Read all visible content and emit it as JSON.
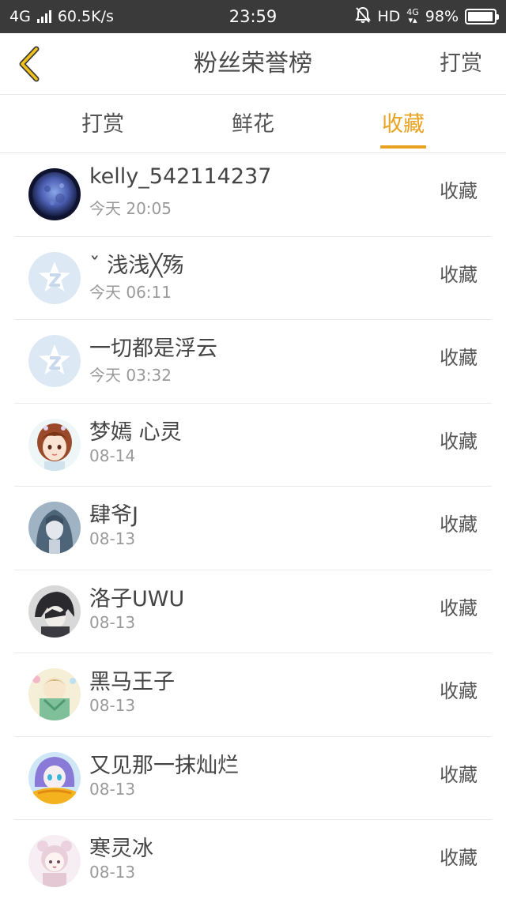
{
  "status_bar": {
    "network": "4G",
    "speed": "60.5K/s",
    "time": "23:59",
    "hd": "HD",
    "hd_sub_top": "4G",
    "hd_sub_bottom": "▾▴",
    "battery": "98%",
    "battery_level": 0.98,
    "icons": [
      "signal-bars-icon",
      "mute-bell-icon",
      "battery-icon"
    ]
  },
  "nav": {
    "title": "粉丝荣誉榜",
    "right_action": "打赏",
    "back_icon": "chevron-left-icon",
    "accent_color": "#e9a21f"
  },
  "tabs": [
    {
      "label": "打赏",
      "active": false
    },
    {
      "label": "鲜花",
      "active": false
    },
    {
      "label": "收藏",
      "active": true
    }
  ],
  "fans": [
    {
      "name": "kelly_542114237",
      "time": "今天 20:05",
      "action": "收藏",
      "avatar": "moon-avatar"
    },
    {
      "name": "ˇ 浅浅╳殇",
      "time": "今天 06:11",
      "action": "收藏",
      "avatar": "default-star-avatar"
    },
    {
      "name": "一切都是浮云",
      "time": "今天 03:32",
      "action": "收藏",
      "avatar": "default-star-avatar"
    },
    {
      "name": "梦嫣 心灵",
      "time": "08-14",
      "action": "收藏",
      "avatar": "anime-girl-avatar"
    },
    {
      "name": "肆爷J",
      "time": "08-13",
      "action": "收藏",
      "avatar": "anime-longhair-avatar"
    },
    {
      "name": "洛子UWU",
      "time": "08-13",
      "action": "收藏",
      "avatar": "anime-dark-avatar"
    },
    {
      "name": "黑马王子",
      "time": "08-13",
      "action": "收藏",
      "avatar": "anime-green-avatar"
    },
    {
      "name": "又见那一抹灿烂",
      "time": "08-13",
      "action": "收藏",
      "avatar": "anime-blue-yellow-avatar"
    },
    {
      "name": "寒灵冰",
      "time": "08-13",
      "action": "收藏",
      "avatar": "anime-pink-avatar"
    }
  ]
}
